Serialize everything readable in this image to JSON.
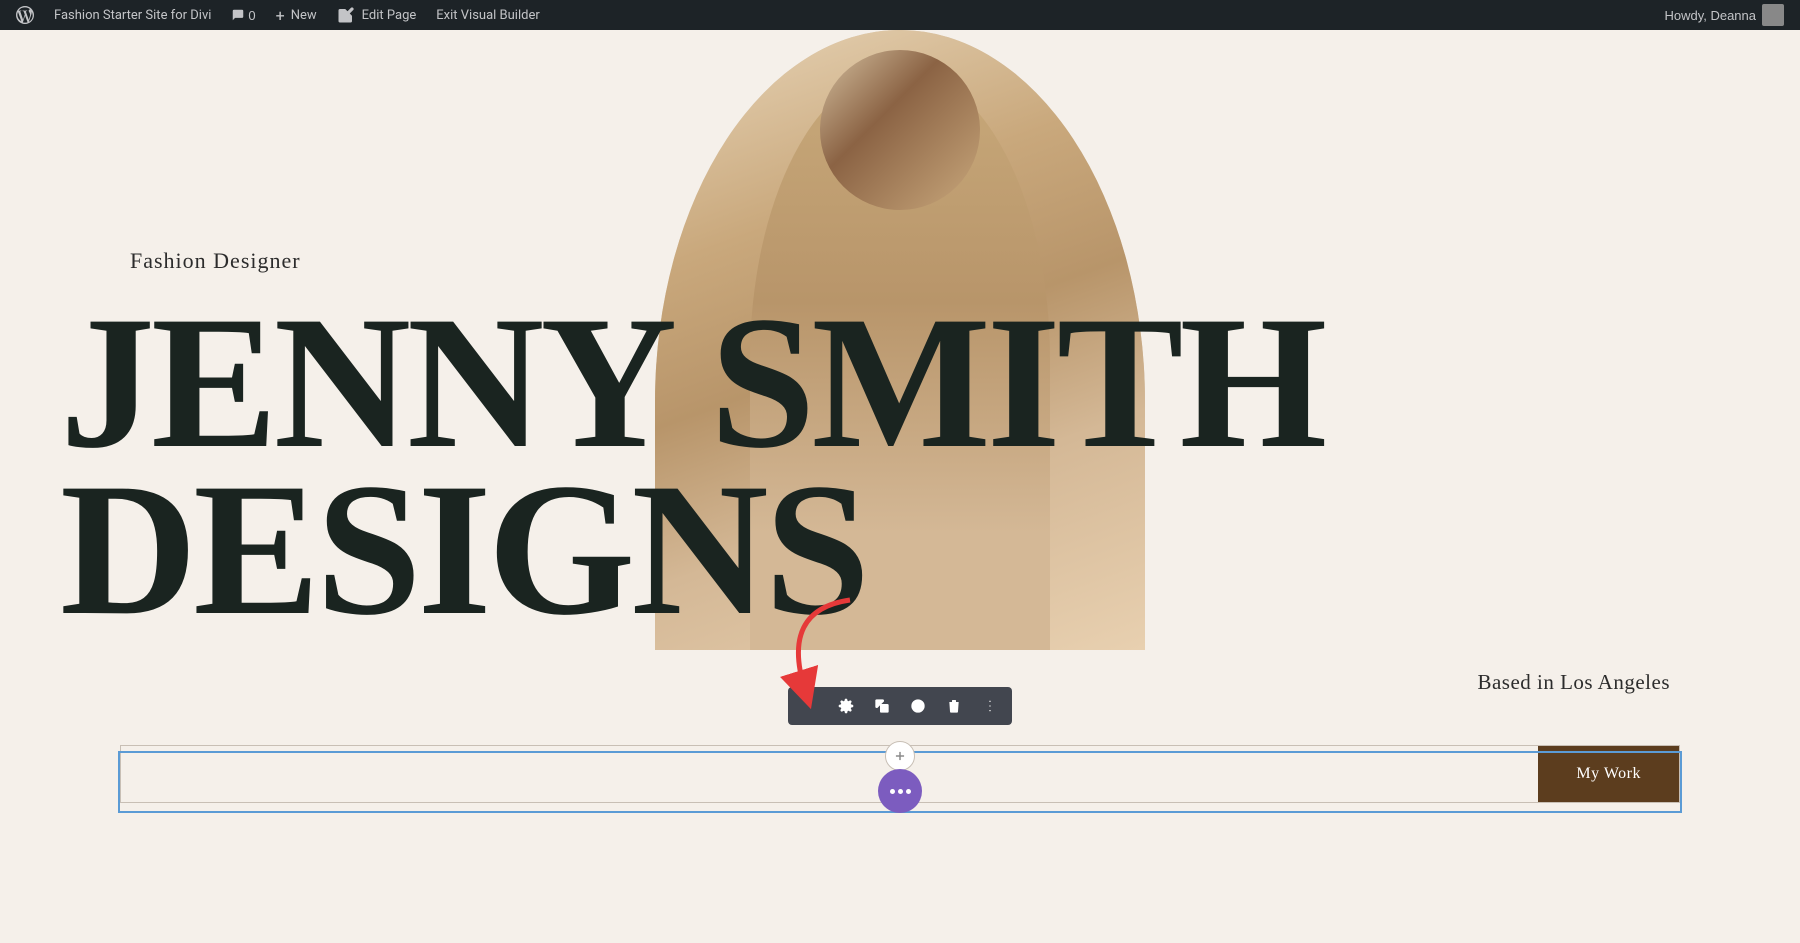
{
  "admin_bar": {
    "site_name": "Fashion Starter Site for Divi",
    "comments_count": "0",
    "new_label": "New",
    "edit_page_label": "Edit Page",
    "exit_builder_label": "Exit Visual Builder",
    "howdy_label": "Howdy, Deanna"
  },
  "hero": {
    "subtitle": "Fashion Designer",
    "name_line1": "JENNY SMITH",
    "name_line2": "DESIGNS",
    "based_label": "Based in Los Angeles",
    "cta_placeholder": "",
    "cta_button_label": "My Work"
  },
  "toolbar": {
    "plus_icon": "+",
    "gear_icon": "⚙",
    "clone_icon": "⧉",
    "power_icon": "⏻",
    "trash_icon": "🗑",
    "more_icon": "⋮"
  }
}
